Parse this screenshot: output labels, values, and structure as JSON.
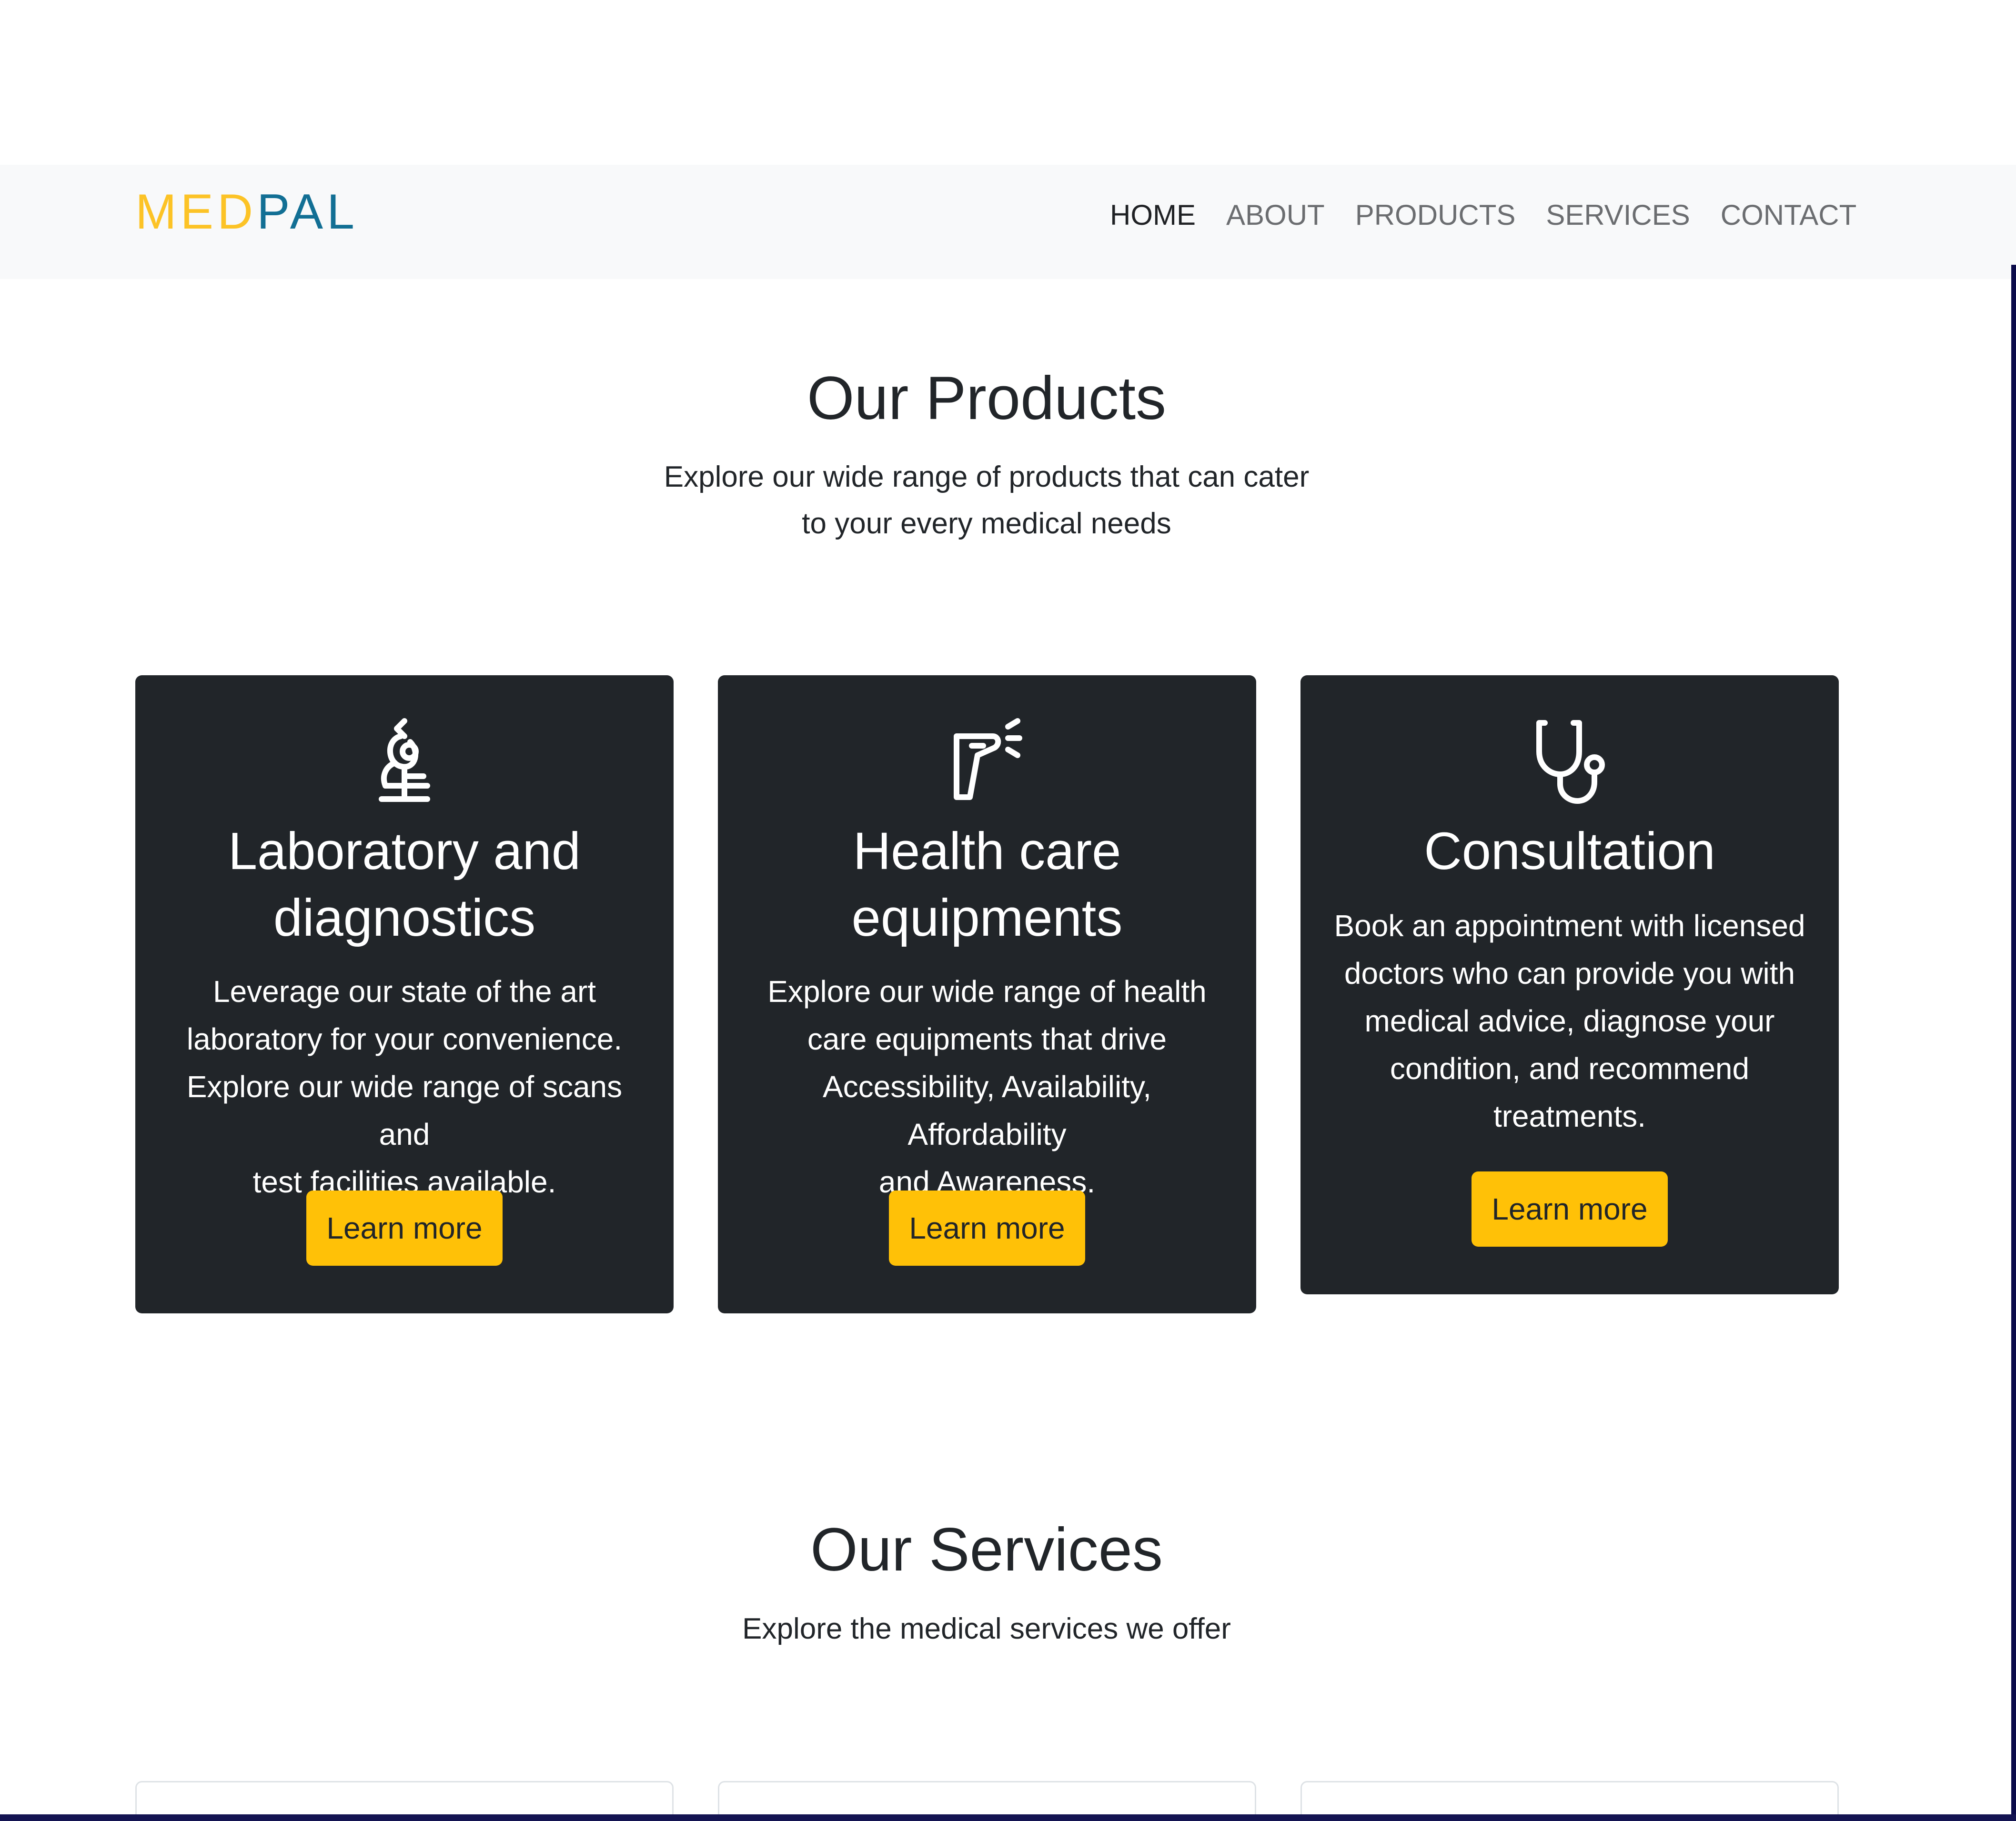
{
  "brand": {
    "part1": "MED",
    "part2": "PAL",
    "color1": "#fcc326",
    "color2": "#126f94"
  },
  "nav": {
    "items": [
      {
        "label": "HOME",
        "active": true
      },
      {
        "label": "ABOUT",
        "active": false
      },
      {
        "label": "PRODUCTS",
        "active": false
      },
      {
        "label": "SERVICES",
        "active": false
      },
      {
        "label": "CONTACT",
        "active": false
      }
    ]
  },
  "products": {
    "title": "Our Products",
    "subtitle_line1": "Explore our wide range of products that can cater",
    "subtitle_line2": "to your every medical needs",
    "cards": [
      {
        "icon": "microscope-icon",
        "title_line1": "Laboratory and",
        "title_line2": "diagnostics",
        "body_lines": [
          "Leverage our state of the art",
          "laboratory for your convenience.",
          "Explore our wide range of scans and",
          "test facilities available."
        ],
        "button": "Learn more"
      },
      {
        "icon": "thermometer-gun-icon",
        "title_line1": "Health care",
        "title_line2": "equipments",
        "body_lines": [
          "Explore our wide range of health",
          "care equipments that drive",
          "Accessibility, Availability, Affordability",
          "and Awareness."
        ],
        "button": "Learn more"
      },
      {
        "icon": "stethoscope-icon",
        "title_line1": "Consultation",
        "body_lines": [
          "Book an appointment with licensed",
          "doctors who can provide you with",
          "medical advice, diagnose your",
          "condition, and recommend",
          "treatments."
        ],
        "button": "Learn more"
      }
    ],
    "card_bg": "#212529",
    "button_color": "#ffc107"
  },
  "services": {
    "title": "Our Services",
    "subtitle": "Explore the medical services we offer"
  }
}
